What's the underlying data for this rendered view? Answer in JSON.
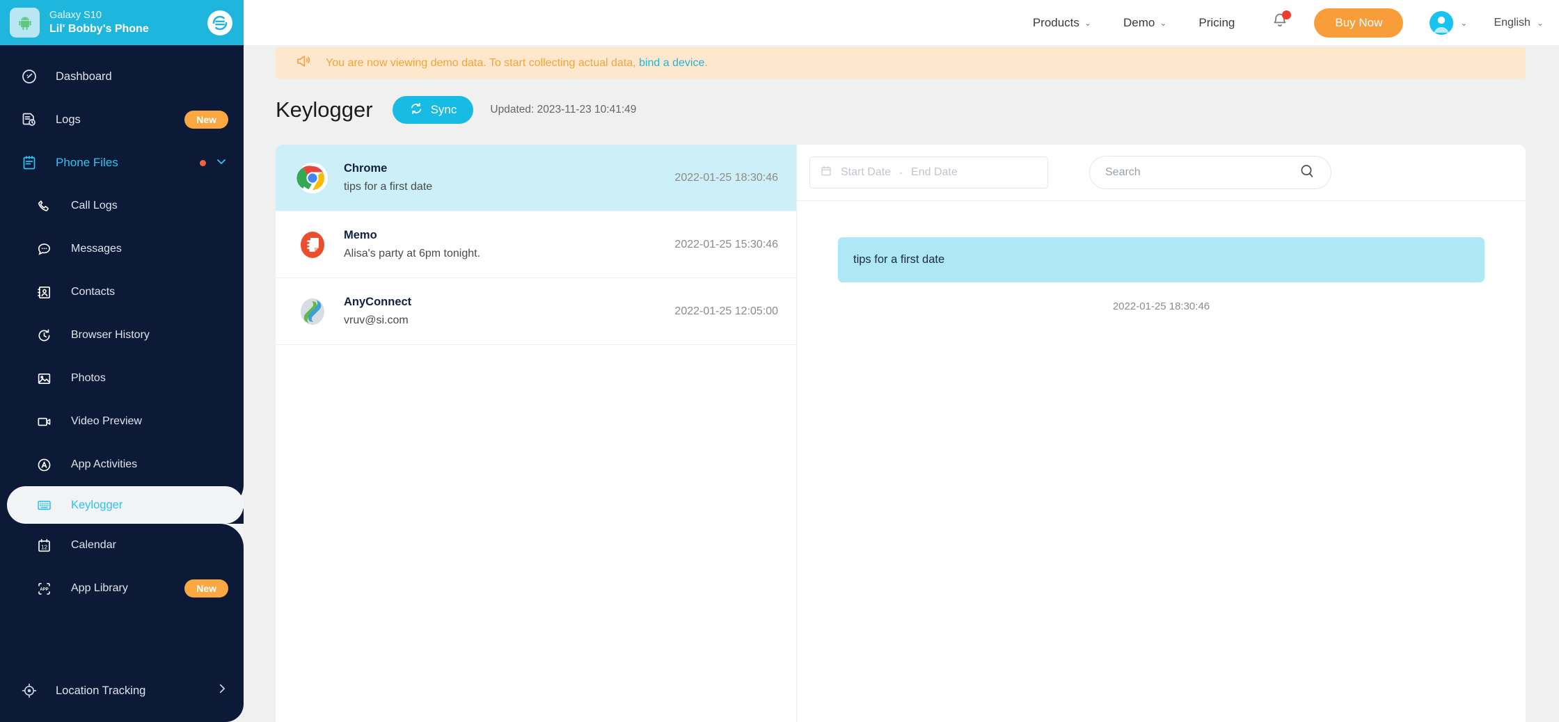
{
  "device": {
    "model": "Galaxy S10",
    "name": "Lil' Bobby's Phone",
    "device_icon": "android-robot-icon",
    "brand_icon": "brand-logo-icon"
  },
  "sidebar": {
    "items": [
      {
        "label": "Dashboard",
        "icon": "dashboard-gauge-icon",
        "type": "top"
      },
      {
        "label": "Logs",
        "icon": "logs-document-icon",
        "type": "top",
        "badge": "New"
      },
      {
        "label": "Phone Files",
        "icon": "clipboard-icon",
        "type": "group",
        "dot": true,
        "chevron": "chevron-down"
      },
      {
        "label": "Call Logs",
        "icon": "phone-icon",
        "type": "sub"
      },
      {
        "label": "Messages",
        "icon": "chat-bubble-icon",
        "type": "sub"
      },
      {
        "label": "Contacts",
        "icon": "contact-card-icon",
        "type": "sub"
      },
      {
        "label": "Browser History",
        "icon": "history-clock-icon",
        "type": "sub"
      },
      {
        "label": "Photos",
        "icon": "photo-image-icon",
        "type": "sub"
      },
      {
        "label": "Video Preview",
        "icon": "video-camera-icon",
        "type": "sub"
      },
      {
        "label": "App Activities",
        "icon": "app-activities-icon",
        "type": "sub"
      },
      {
        "label": "Keylogger",
        "icon": "keyboard-icon",
        "type": "sub",
        "active": true
      },
      {
        "label": "Calendar",
        "icon": "calendar-icon",
        "type": "sub"
      },
      {
        "label": "App Library",
        "icon": "app-library-icon",
        "type": "sub",
        "badge": "New"
      }
    ],
    "bottom": {
      "label": "Location Tracking",
      "icon": "location-target-icon",
      "chevron": "chevron-right"
    }
  },
  "topbar": {
    "products": "Products",
    "demo": "Demo",
    "pricing": "Pricing",
    "buy_now": "Buy Now",
    "language": "English",
    "bell_icon": "notification-bell-icon",
    "avatar_icon": "user-avatar-icon"
  },
  "banner": {
    "icon": "megaphone-icon",
    "text_before": "You are now viewing demo data. To start collecting actual data, ",
    "link": "bind a device",
    "text_after": "."
  },
  "header": {
    "title": "Keylogger",
    "sync_label": "Sync",
    "sync_icon": "sync-refresh-icon",
    "updated": "Updated: 2023-11-23 10:41:49"
  },
  "list": {
    "rows": [
      {
        "app": "Chrome",
        "snippet": "tips for a first date",
        "timestamp": "2022-01-25 18:30:46",
        "icon": "chrome-icon",
        "selected": true
      },
      {
        "app": "Memo",
        "snippet": "Alisa's party at 6pm tonight.",
        "timestamp": "2022-01-25 15:30:46",
        "icon": "memo-icon",
        "selected": false
      },
      {
        "app": "AnyConnect",
        "snippet": "vruv@si.com",
        "timestamp": "2022-01-25 12:05:00",
        "icon": "anyconnect-icon",
        "selected": false
      }
    ]
  },
  "filters": {
    "start_date_placeholder": "Start Date",
    "date_separator": "-",
    "end_date_placeholder": "End Date",
    "calendar_icon": "calendar-small-icon",
    "search_placeholder": "Search",
    "search_icon": "search-magnifier-icon"
  },
  "detail": {
    "message": "tips for a first date",
    "timestamp": "2022-01-25 18:30:46"
  },
  "colors": {
    "sidebar_bg": "#0c1a38",
    "header_cyan": "#1fb6dd",
    "accent_cyan": "#2ec4f0",
    "orange": "#f89d3a",
    "badge_orange": "#fba742",
    "banner_bg": "#fde8cd",
    "bubble_blue": "#aee7f5",
    "row_selected": "#cdeff7",
    "page_bg": "#f0f0f0"
  }
}
